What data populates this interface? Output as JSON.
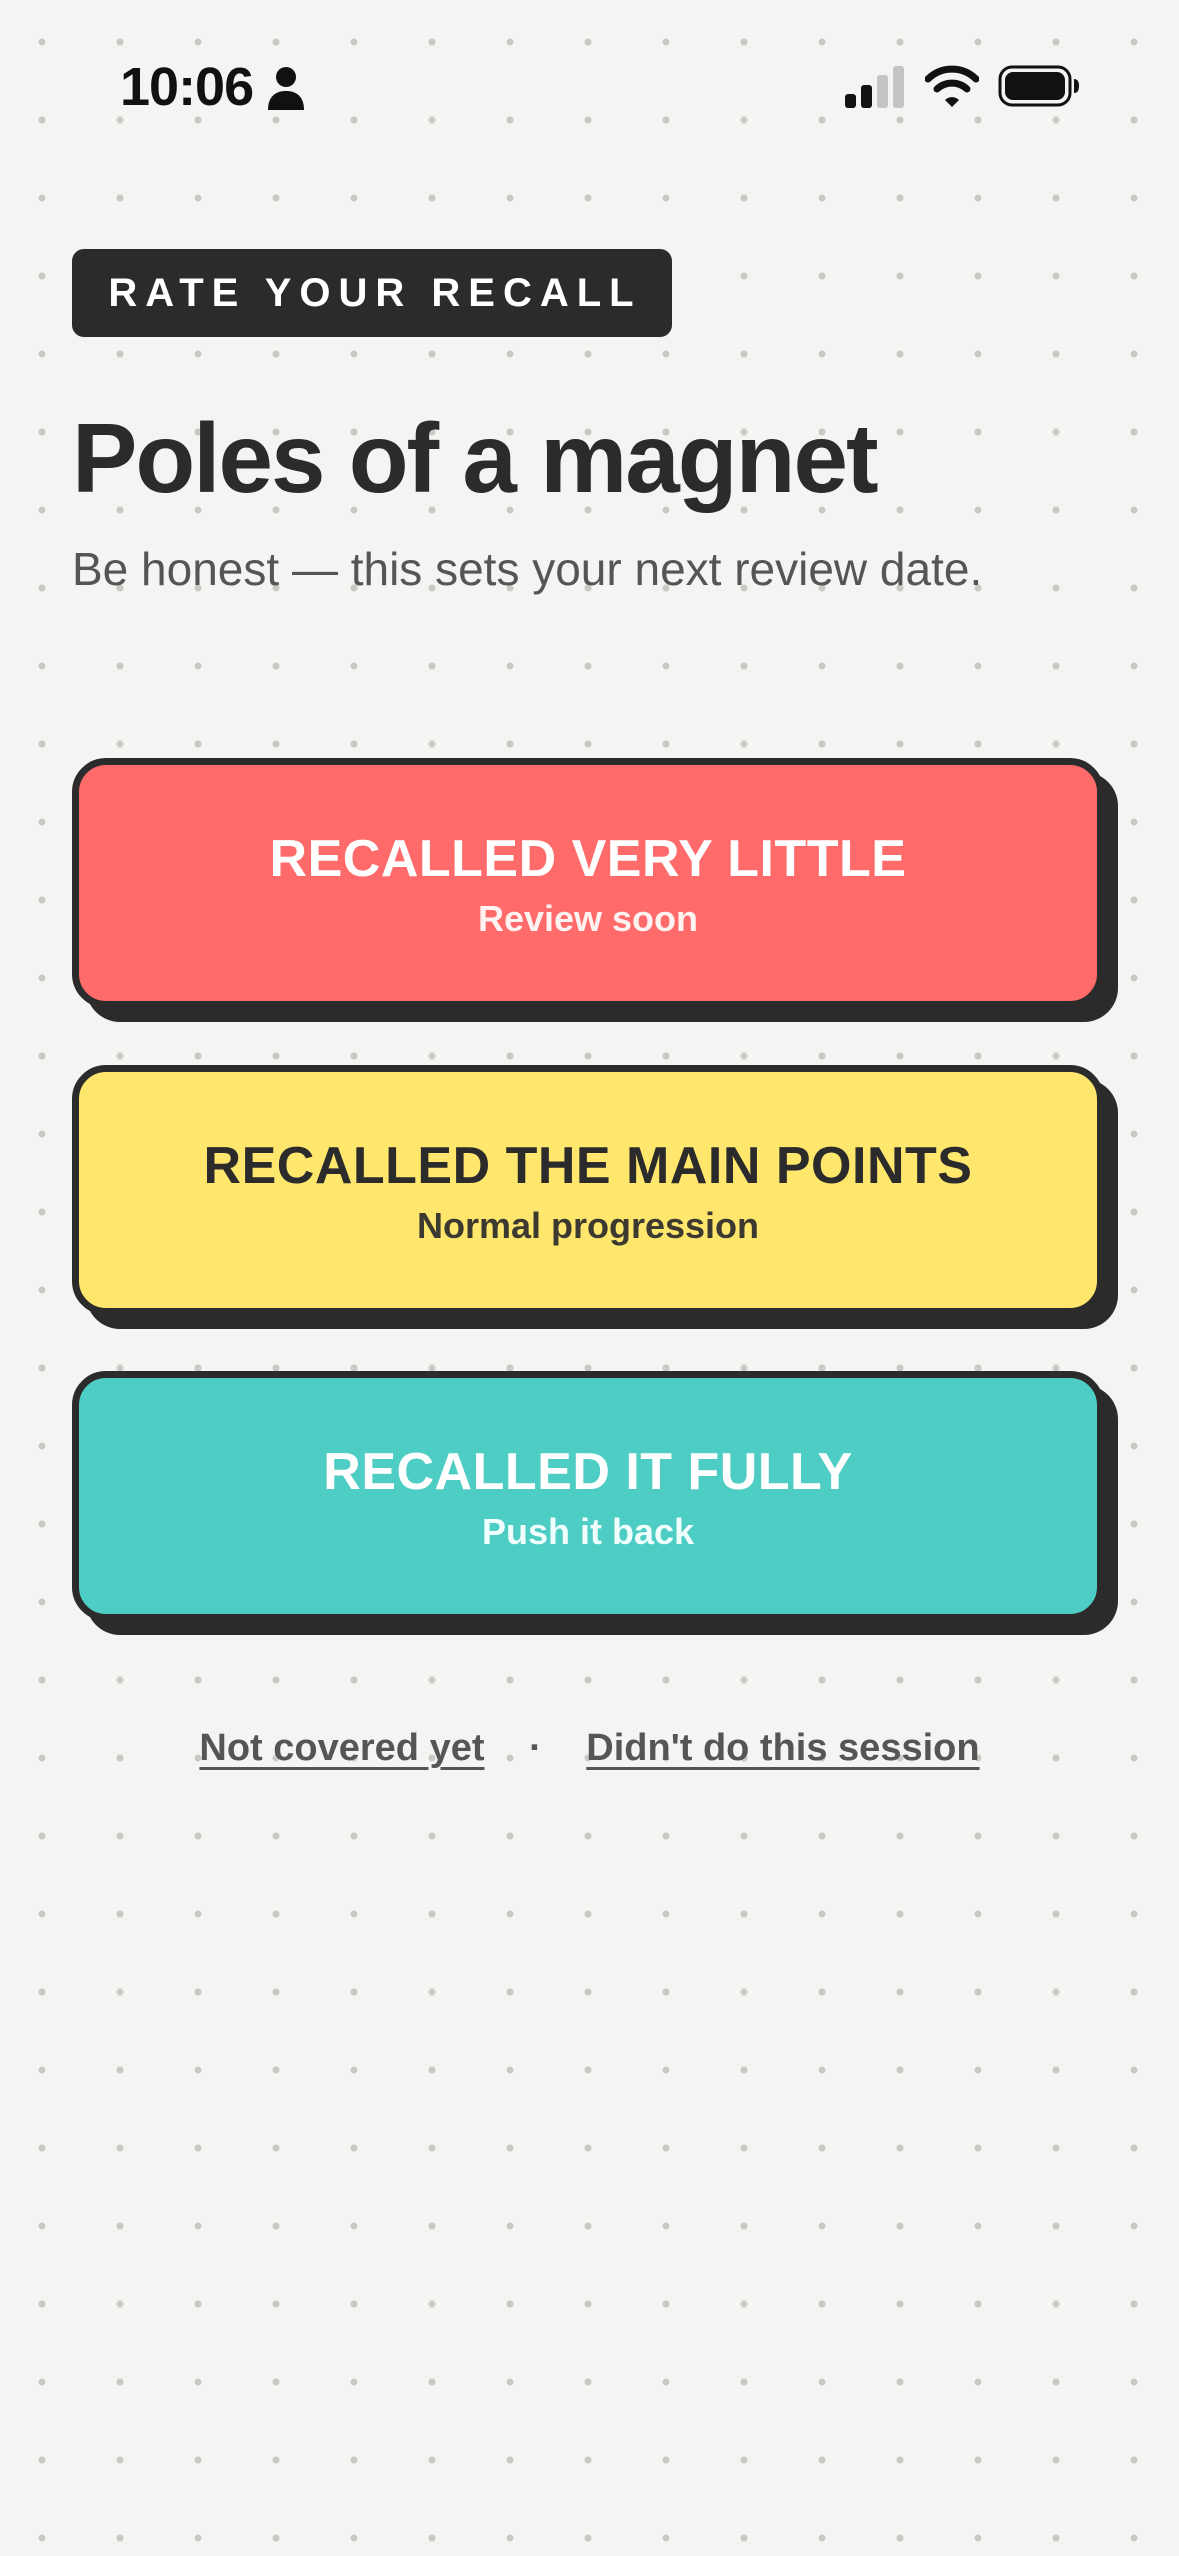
{
  "status_bar": {
    "time": "10:06",
    "icons": [
      "person-icon",
      "cellular-signal-icon",
      "wifi-icon",
      "battery-icon"
    ]
  },
  "header": {
    "tag": "RATE YOUR RECALL",
    "title": "Poles of a magnet",
    "subtitle": "Be honest — this sets your next review date."
  },
  "options": [
    {
      "label": "RECALLED VERY LITTLE",
      "sub": "Review soon",
      "color": "#ff6b6b"
    },
    {
      "label": "RECALLED THE MAIN POINTS",
      "sub": "Normal progression",
      "color": "#ffe66d"
    },
    {
      "label": "RECALLED IT FULLY",
      "sub": "Push it back",
      "color": "#4ecdc4"
    }
  ],
  "footer": {
    "not_covered": "Not covered yet",
    "separator": "·",
    "skipped": "Didn't do this session"
  },
  "colors": {
    "background": "#f4f4f2",
    "ink": "#2b2b2b",
    "muted_text": "#555555"
  }
}
